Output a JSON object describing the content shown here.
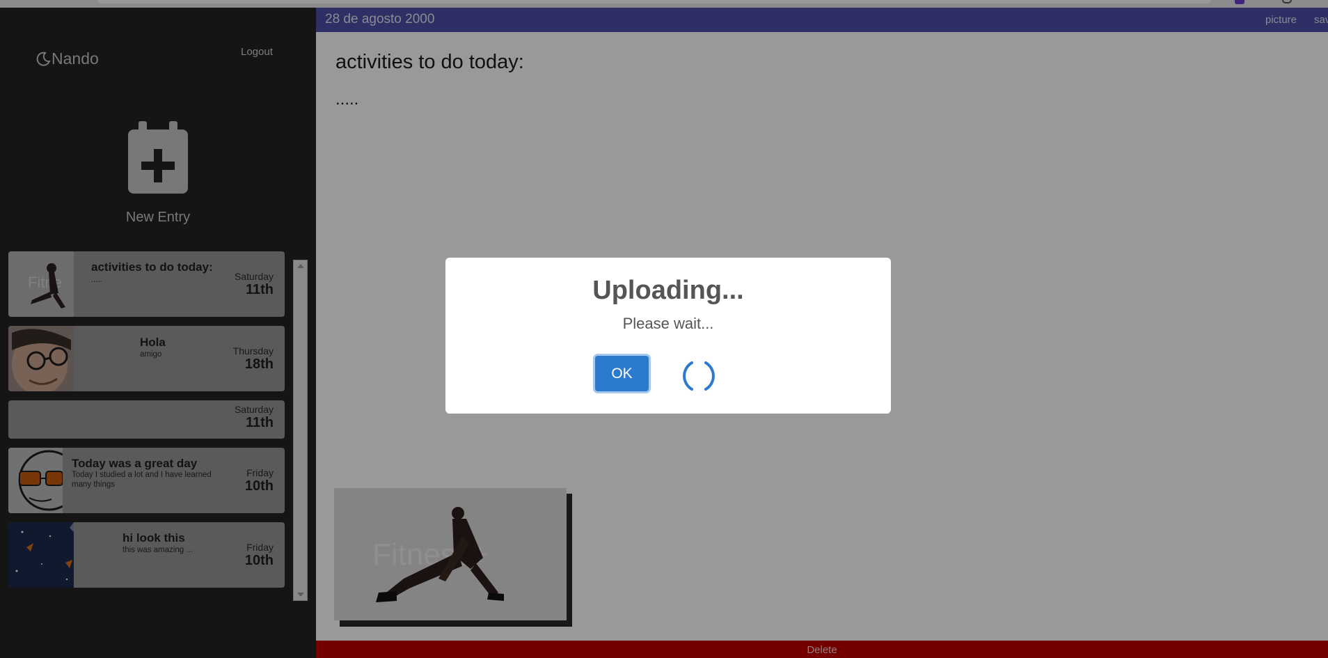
{
  "app": {
    "user_name": "Nando",
    "logout_label": "Logout",
    "new_entry_label": "New Entry"
  },
  "entries": [
    {
      "title": "activities to do today:",
      "preview": ".....",
      "day": "Saturday",
      "date": "11th",
      "thumb": "fitness-photo"
    },
    {
      "title": "Hola",
      "preview": "amigo",
      "day": "Thursday",
      "date": "18th",
      "thumb": "selfie-photo"
    },
    {
      "title": "",
      "preview": "",
      "day": "Saturday",
      "date": "11th",
      "thumb": ""
    },
    {
      "title": "Today was a great day",
      "preview": "Today I studied a lot and I have learned many things",
      "day": "Friday",
      "date": "10th",
      "thumb": "glasses-drawing"
    },
    {
      "title": "hi look this",
      "preview": "this was amazing ...",
      "day": "Friday",
      "date": "10th",
      "thumb": "space-image"
    }
  ],
  "editor": {
    "date": "28 de agosto 2000",
    "picture_label": "picture",
    "save_label": "sav",
    "title": "activities to do today:",
    "body": ".....",
    "photo_watermark": "Fitness+",
    "delete_label": "Delete"
  },
  "dialog": {
    "title": "Uploading...",
    "text": "Please wait...",
    "ok_label": "OK"
  },
  "colors": {
    "date_bar": "#4b4fa8",
    "delete_bar": "#c40000",
    "ok_button": "#2c7ad0",
    "sidebar": "#232323"
  }
}
